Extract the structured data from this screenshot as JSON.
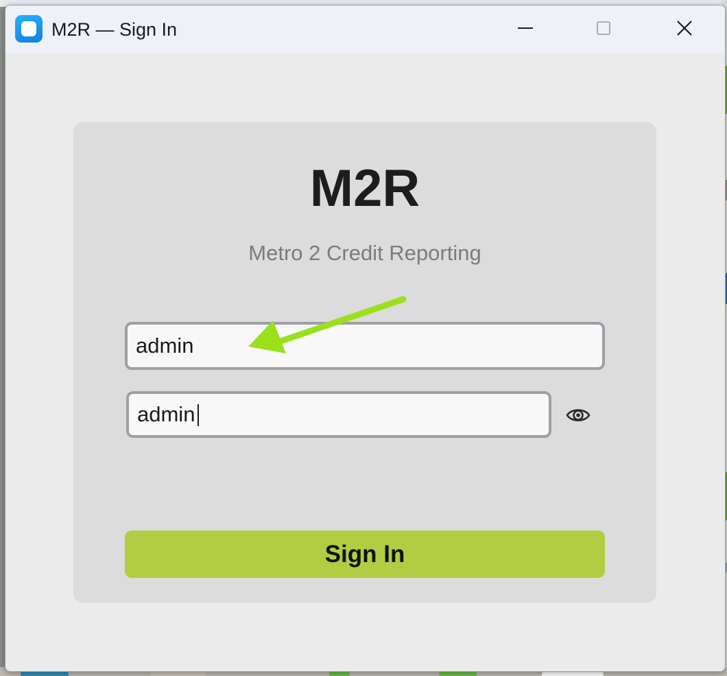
{
  "window": {
    "title": "M2R — Sign In",
    "icon": "app-icon",
    "controls": [
      "minimize-icon",
      "maximize-icon",
      "close-icon"
    ]
  },
  "login": {
    "brand": "M2R",
    "subtitle": "Metro 2 Credit Reporting",
    "username_value": "admin",
    "password_value": "admin",
    "password_visible": true,
    "password_toggle_icon": "eye-icon",
    "submit_label": "Sign In"
  },
  "colors": {
    "window_background": "#ebebeb",
    "card_background": "#dcdcdc",
    "field_background": "#f8f8f8",
    "field_border": "#9ca0a6",
    "button_accent": "#b2cc44",
    "subtitle_text": "#7b7b7b",
    "annotation_arrow": "#9be01c"
  },
  "annotation": {
    "type": "arrow",
    "points_to": "username-field"
  }
}
